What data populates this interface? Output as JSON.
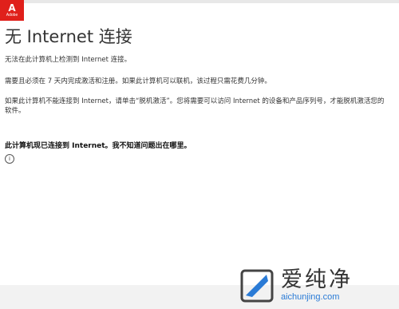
{
  "logo": {
    "glyph": "A",
    "word": "Adobe"
  },
  "title": "无 Internet 连接",
  "paragraphs": [
    "无法在此计算机上检测到 Internet 连接。",
    "需要且必须在 7 天内完成激活和注册。如果此计算机可以联机，该过程只需花费几分钟。",
    "如果此计算机不能连接到 Internet，请单击“脱机激活”。您将需要可以访问 Internet 的设备和产品序列号，才能脱机激活您的软件。"
  ],
  "status_link": "此计算机现已连接到 Internet。我不知道问题出在哪里。",
  "info_icon": "i",
  "watermark": {
    "cn": "爱纯净",
    "url": "aichunjing.com"
  }
}
